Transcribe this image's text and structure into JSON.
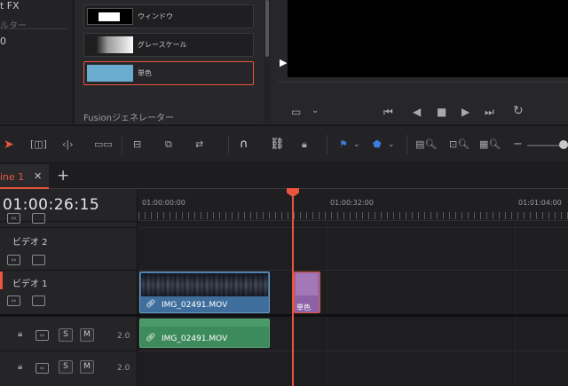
{
  "left_panel": {
    "line1": "t FX",
    "line2": "ルター",
    "line3": "0"
  },
  "generators": {
    "items": [
      {
        "label": "ウィンドウ"
      },
      {
        "label": "グレースケール"
      },
      {
        "label": "単色"
      }
    ],
    "selected": "単色",
    "fusion_header": "Fusionジェネレーター"
  },
  "viewer": {
    "transport": [
      "skip-to-start-icon",
      "step-back-icon",
      "stop-icon",
      "play-icon",
      "skip-to-end-icon",
      "loop-icon"
    ]
  },
  "tabs": {
    "active_label": "ine 1",
    "close": "✕",
    "add": "+"
  },
  "timeline": {
    "timecode": "01:00:26:15",
    "ruler_labels": [
      "01:00:00:00",
      "01:00:32:00",
      "01:01:04:00"
    ],
    "tracks": {
      "video2": {
        "name": "ビデオ 2"
      },
      "video1": {
        "name": "ビデオ 1"
      },
      "audio": [
        {
          "mute": "M",
          "solo": "S",
          "volume": "2.0"
        },
        {
          "mute": "M",
          "solo": "S",
          "volume": "2.0"
        }
      ]
    },
    "clips": {
      "video_clip": "IMG_02491.MOV",
      "solid_clip": "単色",
      "audio_clip": "IMG_02491.MOV"
    }
  },
  "colors": {
    "accent": "#e9553f",
    "video_clip": "#3f6e9c",
    "audio_clip": "#3d8a5c",
    "solid_clip": "#8e62a6",
    "solid_color_swatch": "#6aaccf"
  }
}
